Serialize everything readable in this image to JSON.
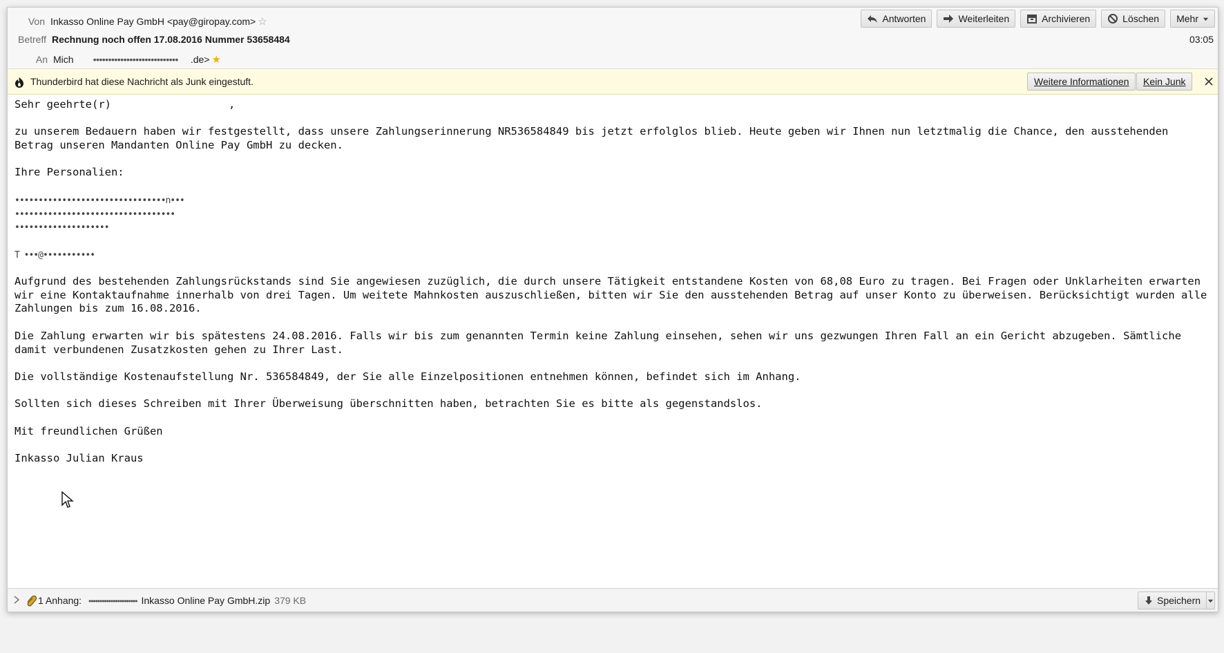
{
  "header": {
    "from_label": "Von",
    "from_value": "Inkasso Online Pay GmbH <pay@giropay.com>",
    "subject_label": "Betreff",
    "subject_value": "Rechnung noch offen 17.08.2016 Nummer 53658484",
    "to_label": "An",
    "to_name": "Mich",
    "to_redacted": "••••••••••••••••••••••••••••",
    "to_suffix": ".de>",
    "time": "03:05"
  },
  "toolbar": {
    "reply": "Antworten",
    "forward": "Weiterleiten",
    "archive": "Archivieren",
    "delete": "Löschen",
    "more": "Mehr"
  },
  "junkbar": {
    "message": "Thunderbird hat diese Nachricht als Junk eingestuft.",
    "more_info": "Weitere Informationen",
    "not_junk": "Kein Junk"
  },
  "body": {
    "greeting": "Sehr geehrte(r)",
    "greeting_comma": ",",
    "para1": "zu unserem Bedauern haben wir festgestellt, dass unsere Zahlungserinnerung NR536584849 bis jetzt erfolglos blieb. Heute geben wir Ihnen nun letztmalig die Chance, den ausstehenden\nBetrag unseren Mandanten Online Pay GmbH zu decken.",
    "personal_heading": "Ihre Personalien:",
    "personal_lines": [
      "••••••••••••••••••••••••••••••••n•••",
      "••••••••••••••••••••••••••••••••••",
      "••••••••••••••••••••",
      "T  •••@•••••••••••"
    ],
    "para2": "Aufgrund des bestehenden Zahlungsrückstands sind Sie angewiesen zuzüglich, die durch unsere Tätigkeit entstandene Kosten von 68,08 Euro zu tragen. Bei Fragen oder Unklarheiten erwarten\nwir eine Kontaktaufnahme innerhalb von drei Tagen. Um weitete Mahnkosten auszuschließen, bitten wir Sie den ausstehenden Betrag auf unser Konto zu überweisen. Berücksichtigt wurden alle\nZahlungen bis zum 16.08.2016.",
    "para3": "Die Zahlung erwarten wir bis spätestens 24.08.2016. Falls wir bis zum genannten Termin keine Zahlung einsehen, sehen wir uns gezwungen Ihren Fall an ein Gericht abzugeben. Sämtliche\ndamit verbundenen Zusatzkosten gehen zu Ihrer Last.",
    "para4": "Die vollständige Kostenaufstellung Nr. 536584849, der Sie alle Einzelpositionen entnehmen können, befindet sich im Anhang.",
    "para5": "Sollten sich dieses Schreiben mit Ihrer Überweisung überschnitten haben, betrachten Sie es bitte als gegenstandslos.",
    "closing": "Mit freundlichen Grüßen",
    "signature": "Inkasso Julian Kraus"
  },
  "attachment": {
    "label": "1 Anhang:",
    "redacted": "••••••••••••••••••••••",
    "filename": "Inkasso Online Pay GmbH.zip",
    "size": "379 KB",
    "save": "Speichern"
  },
  "colors": {
    "junkbar_bg": "#fefbe0",
    "star_filled": "#f0b400"
  }
}
